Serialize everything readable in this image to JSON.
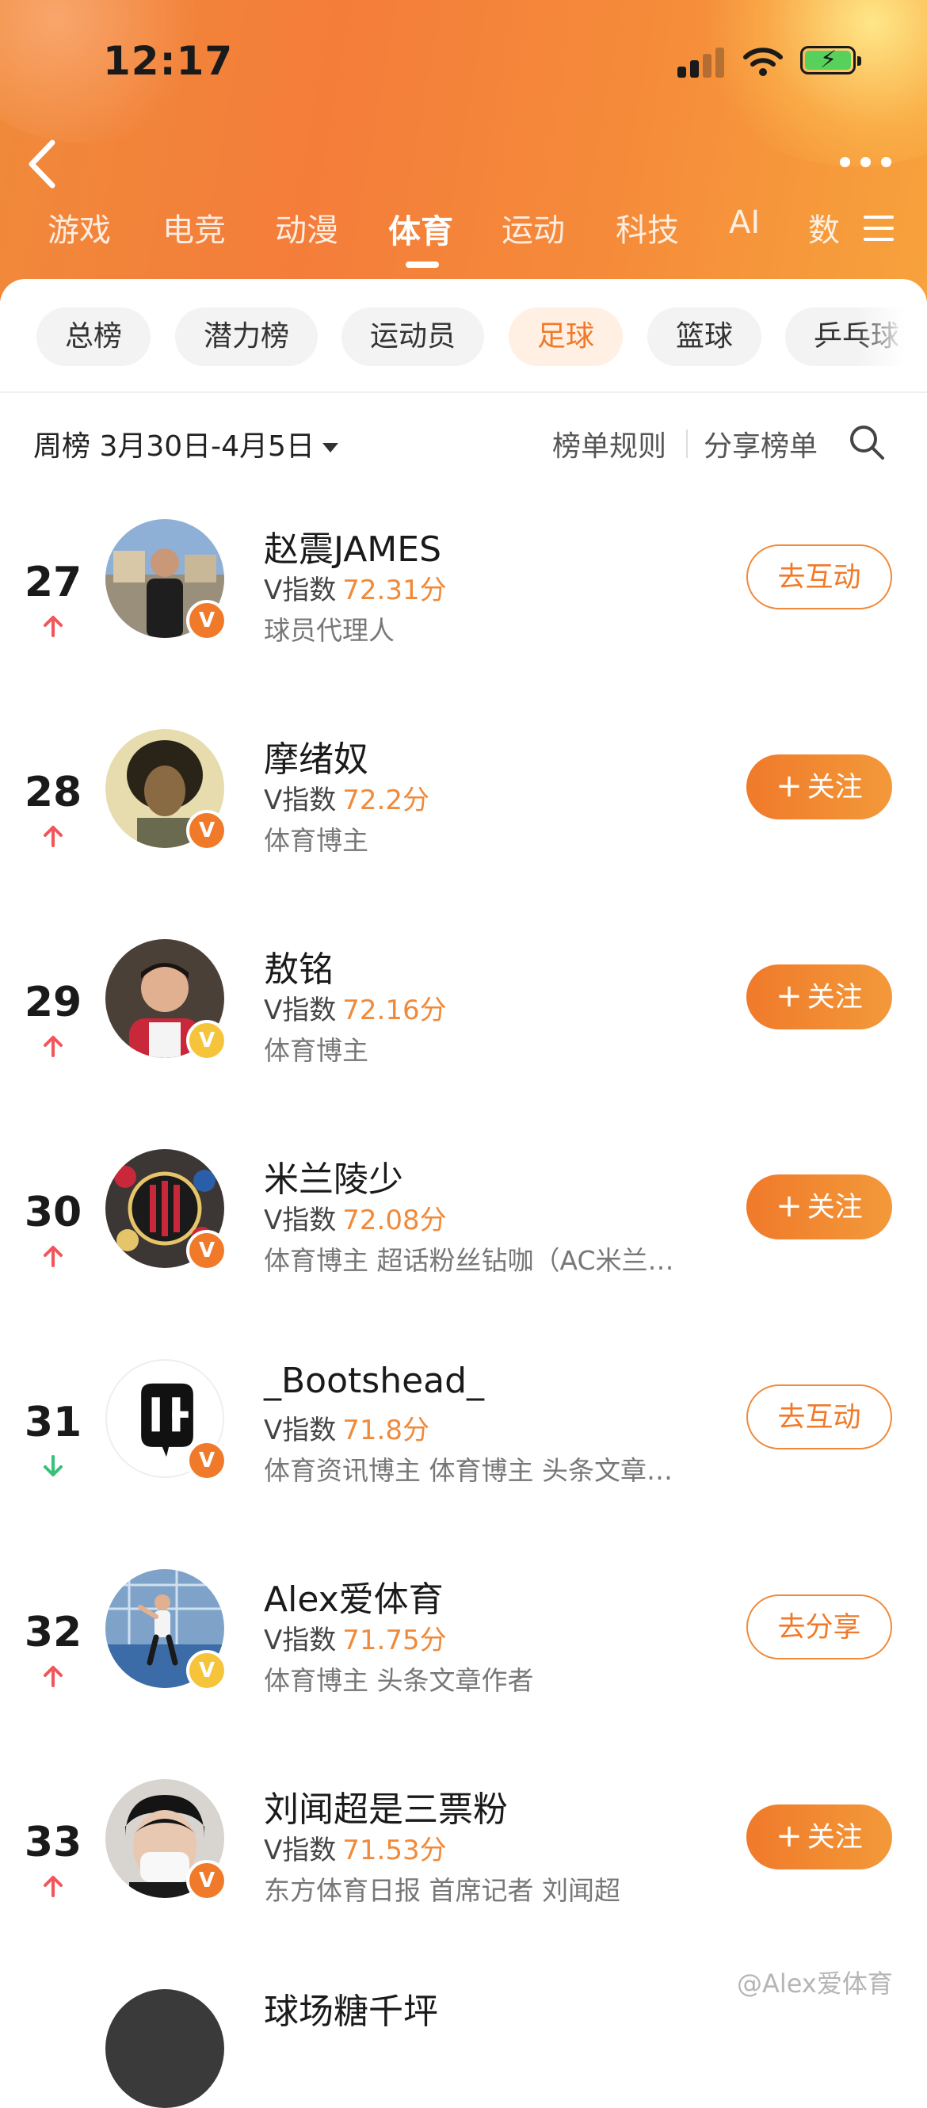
{
  "status_bar": {
    "time": "12:17"
  },
  "category_tabs": [
    {
      "label": "游戏",
      "active": false
    },
    {
      "label": "电竞",
      "active": false
    },
    {
      "label": "动漫",
      "active": false
    },
    {
      "label": "体育",
      "active": true
    },
    {
      "label": "运动",
      "active": false
    },
    {
      "label": "科技",
      "active": false
    },
    {
      "label": "AI",
      "active": false
    },
    {
      "label": "数",
      "active": false
    }
  ],
  "sub_tabs": [
    {
      "label": "总榜",
      "active": false
    },
    {
      "label": "潜力榜",
      "active": false
    },
    {
      "label": "运动员",
      "active": false
    },
    {
      "label": "足球",
      "active": true
    },
    {
      "label": "篮球",
      "active": false
    },
    {
      "label": "乒乓球",
      "active": false
    }
  ],
  "filter": {
    "period": "周榜 3月30日-4月5日",
    "rules_label": "榜单规则",
    "share_label": "分享榜单"
  },
  "score_prefix": "V指数",
  "rows": [
    {
      "rank": "27",
      "trend": "up",
      "name": "赵震JAMES",
      "score": "72.31分",
      "desc": "球员代理人",
      "button": "去互动",
      "button_style": "outline",
      "badge": "orange"
    },
    {
      "rank": "28",
      "trend": "up",
      "name": "摩绪奴",
      "score": "72.2分",
      "desc": "体育博主",
      "button": "关注",
      "button_style": "filled",
      "badge": "orange"
    },
    {
      "rank": "29",
      "trend": "up",
      "name": "敖铭",
      "score": "72.16分",
      "desc": "体育博主",
      "button": "关注",
      "button_style": "filled",
      "badge": "gold"
    },
    {
      "rank": "30",
      "trend": "up",
      "name": "米兰陵少",
      "score": "72.08分",
      "desc": "体育博主 超话粉丝钻咖（AC米兰…",
      "button": "关注",
      "button_style": "filled",
      "badge": "orange"
    },
    {
      "rank": "31",
      "trend": "down",
      "name": "_Bootshead_",
      "score": "71.8分",
      "desc": "体育资讯博主 体育博主 头条文章…",
      "button": "去互动",
      "button_style": "outline",
      "badge": "orange"
    },
    {
      "rank": "32",
      "trend": "up",
      "name": "Alex爱体育",
      "score": "71.75分",
      "desc": "体育博主 头条文章作者",
      "button": "去分享",
      "button_style": "outline",
      "badge": "gold"
    },
    {
      "rank": "33",
      "trend": "up",
      "name": "刘闻超是三票粉",
      "score": "71.53分",
      "desc": "东方体育日报 首席记者 刘闻超",
      "button": "关注",
      "button_style": "filled",
      "badge": "orange"
    }
  ],
  "peek_row_name": "球场糖千坪",
  "watermark": "@Alex爱体育",
  "colors": {
    "accent": "#f07a2a",
    "trend_up": "#f2555a",
    "trend_down": "#39c07a"
  }
}
